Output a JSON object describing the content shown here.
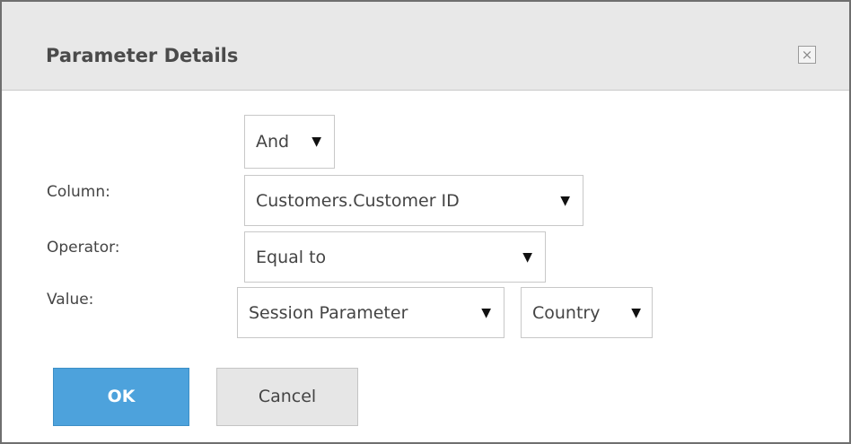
{
  "dialog": {
    "title": "Parameter Details",
    "close_symbol": "×"
  },
  "form": {
    "conjunction": {
      "value": "And"
    },
    "column": {
      "label": "Column:",
      "value": "Customers.Customer ID"
    },
    "operator": {
      "label": "Operator:",
      "value": "Equal to"
    },
    "value": {
      "label": "Value:",
      "source_type": "Session Parameter",
      "parameter": "Country"
    },
    "dropdown_arrow": "▼"
  },
  "buttons": {
    "ok_label": "OK",
    "cancel_label": "Cancel"
  },
  "colors": {
    "ok_button": "#4da2dc",
    "title_bar": "#e8e8e8"
  }
}
